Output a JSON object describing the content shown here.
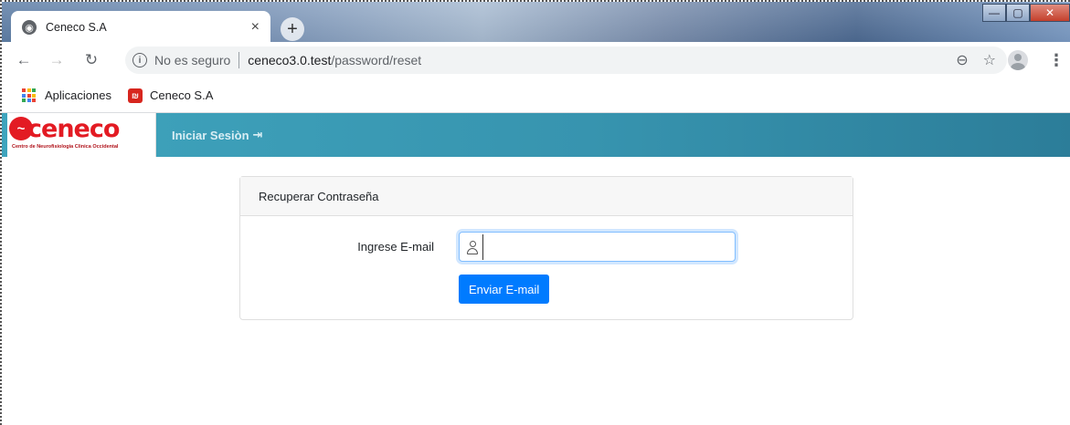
{
  "browser": {
    "tab_title": "Ceneco S.A",
    "tab_close": "×",
    "new_tab": "+",
    "security_label": "No es seguro",
    "url_host": "ceneco3.0.test",
    "url_path": "/password/reset",
    "icons": [
      "back-arrow-icon",
      "forward-arrow-icon",
      "reload-icon",
      "info-icon",
      "zoom-icon",
      "star-icon",
      "profile-icon",
      "menu-kebab-icon"
    ]
  },
  "bookmarks": {
    "apps_label": "Aplicaciones",
    "items": [
      {
        "label": "Ceneco S.A"
      }
    ]
  },
  "app": {
    "brand_name": "ceneco",
    "brand_subtitle": "Centro de Neurofisiologia Clinica Occidental",
    "nav_login": "Iniciar Sesiòn",
    "nav_login_icon": "⇥",
    "accent_color": "#3a9cb7",
    "brand_color": "#e31b23"
  },
  "card": {
    "header": "Recuperar Contraseña",
    "email_label": "Ingrese E-mail",
    "email_value": "",
    "email_placeholder": "",
    "submit_label": "Enviar E-mail",
    "submit_color": "#007bff"
  }
}
